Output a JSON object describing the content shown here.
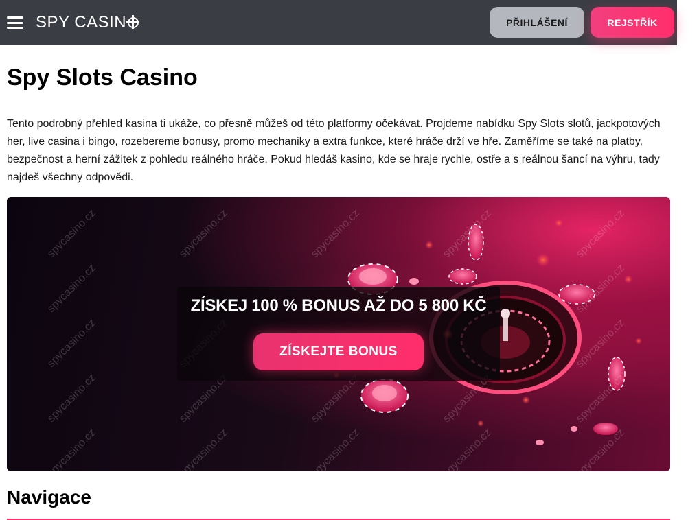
{
  "header": {
    "logo_text": "SPY CASIN",
    "login_label": "PŘIHLÁŠENÍ",
    "register_label": "REJSTŘÍK"
  },
  "main": {
    "title": "Spy Slots Casino",
    "intro": "Tento podrobný přehled kasina ti ukáže, co přesně můžeš od této platformy očekávat. Projdeme nabídku Spy Slots slotů, jackpotových her, live casina i bingo, rozebereme bonusy, promo mechaniky a extra funkce, které hráče drží ve hře. Zaměříme se také na platby, bezpečnost a herní zážitek z pohledu reálného hráče. Pokud hledáš kasino, kde se hraje rychle, ostře a s reálnou šancí na výhru, tady najdeš všechny odpovědi.",
    "banner": {
      "promo_text": "ZÍSKEJ 100 % BONUS AŽ DO 5 800 KČ",
      "button_label": "ZÍSKEJTE BONUS",
      "watermark": "spycasino.cz"
    },
    "section_title": "Navigace"
  },
  "colors": {
    "topbar": "#3a3d44",
    "accent": "#ff2e6b",
    "login_bg": "#b4b7bd"
  },
  "icons": [
    "menu-icon",
    "logo-crosshair-icon"
  ]
}
